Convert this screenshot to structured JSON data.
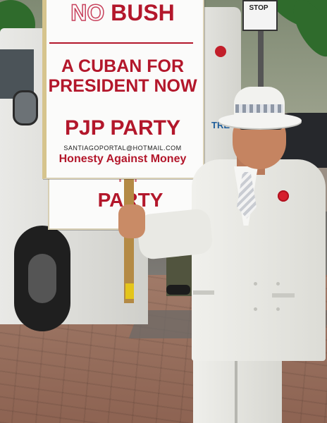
{
  "sign": {
    "line1_a": "NO",
    "line1_b": "BUSH",
    "line2": "A CUBAN FOR",
    "line3": "PRESIDENT NOW",
    "line4": "PJP PARTY",
    "email": "SANTIAGOPORTAL@HOTMAIL.COM",
    "slogan": "Honesty Against Money"
  },
  "back_sign": {
    "line1": "PJP",
    "line2": "PARTY"
  },
  "street_sign": {
    "text": "STOP"
  },
  "bus": {
    "text": "TRE"
  },
  "colors": {
    "sign_red": "#b3172b",
    "suit_white": "#eeeeea",
    "flower_red": "#d61f2d",
    "pole_tip_yellow": "#e4c51b"
  }
}
